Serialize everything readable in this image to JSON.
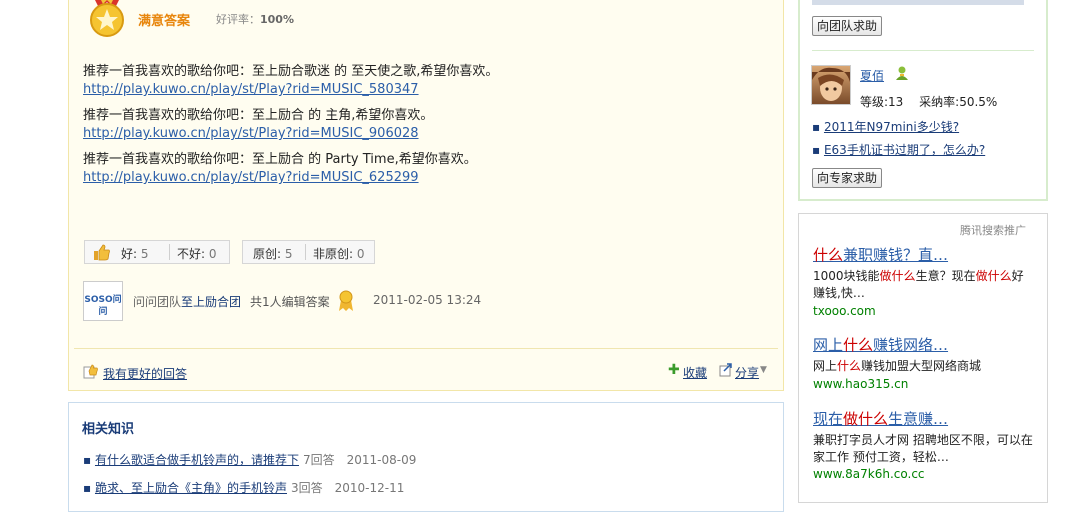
{
  "answer": {
    "best_label": "满意答案",
    "rate_label": "好评率：",
    "rate_value": "100%",
    "lines": [
      "推荐一首我喜欢的歌给你吧：至上励合歌迷 的 至天使之歌,希望你喜欢。",
      "http://play.kuwo.cn/play/st/Play?rid=MUSIC_580347",
      "推荐一首我喜欢的歌给你吧：至上励合 的 主角,希望你喜欢。",
      "http://play.kuwo.cn/play/st/Play?rid=MUSIC_906028",
      "推荐一首我喜欢的歌给你吧：至上励合 的 Party Time,希望你喜欢。",
      "http://play.kuwo.cn/play/st/Play?rid=MUSIC_625299"
    ],
    "votes": {
      "good_label": "好:",
      "good_count": "5",
      "bad_label": "不好:",
      "bad_count": "0",
      "original_label": "原创:",
      "original_count": "5",
      "non_original_label": "非原创:",
      "non_original_count": "0"
    },
    "logo_text": "SOSO问问",
    "team_prefix": "问问团队",
    "team_name": "至上励合团",
    "editors": "共1人编辑答案",
    "timestamp": "2011-02-05 13:24",
    "better_answer": "我有更好的回答",
    "favorite": "收藏",
    "share": "分享"
  },
  "related": {
    "title": "相关知识",
    "items": [
      {
        "title": "有什么歌适合做手机铃声的，请推荐下",
        "answers": "7回答",
        "date": "2011-08-09"
      },
      {
        "title": "跪求、至上励合《主角》的手机铃声",
        "answers": "3回答",
        "date": "2010-12-11"
      }
    ]
  },
  "sidebar": {
    "help_team_button": "向团队求助",
    "expert": {
      "name": "夏佰",
      "level_label": "等级:13",
      "adopt_label": "采纳率:50.5%"
    },
    "expert_links": [
      "2011年N97mini多少钱?",
      "E63手机证书过期了，怎么办?"
    ],
    "help_expert_button": "向专家求助",
    "ad_label": "腾讯搜索推广",
    "ads": [
      {
        "title_pre": "",
        "title_hl1": "什么",
        "title_mid": "兼职赚钱？直…",
        "title_hl2": "",
        "title_post": "",
        "desc_pre": "1000块钱能",
        "desc_hl1": "做什么",
        "desc_mid": "生意？现在",
        "desc_hl2": "做什么",
        "desc_post": "好赚钱,快…",
        "url": "txooo.com"
      },
      {
        "title_pre": "网上",
        "title_hl1": "什么",
        "title_mid": "赚钱网络…",
        "title_hl2": "",
        "title_post": "",
        "desc_pre": "网上",
        "desc_hl1": "什么",
        "desc_mid": "赚钱加盟大型网络商城",
        "desc_hl2": "",
        "desc_post": "",
        "url": "www.hao315.cn"
      },
      {
        "title_pre": "现在",
        "title_hl1": "做什么",
        "title_mid": "生意赚…",
        "title_hl2": "",
        "title_post": "",
        "desc_pre": "兼职打字员人才网 招聘地区不限，可以在家工作 预付工资，轻松…",
        "desc_hl1": "",
        "desc_mid": "",
        "desc_hl2": "",
        "desc_post": "",
        "url": "www.8a7k6h.co.cc"
      }
    ]
  },
  "colors": {
    "accent_orange": "#e8860d",
    "link_blue": "#2b5ea8",
    "ad_red": "#cc0000",
    "ad_green": "#008000"
  }
}
